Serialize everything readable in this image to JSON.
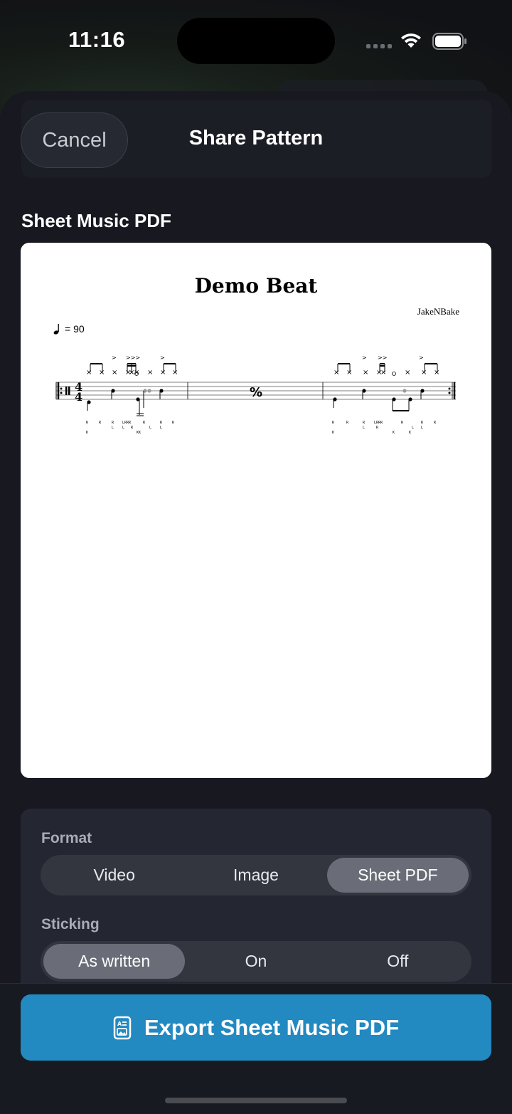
{
  "status_bar": {
    "time": "11:16"
  },
  "header": {
    "cancel_label": "Cancel",
    "title": "Share Pattern"
  },
  "section": {
    "title": "Sheet Music PDF"
  },
  "preview": {
    "title": "Demo Beat",
    "composer": "JakeNBake",
    "tempo_text": "= 90",
    "time_signature": {
      "top": "4",
      "bottom": "4"
    },
    "repeat_symbol": "%"
  },
  "options": {
    "format": {
      "label": "Format",
      "items": [
        "Video",
        "Image",
        "Sheet PDF"
      ],
      "selected": "Sheet PDF"
    },
    "sticking": {
      "label": "Sticking",
      "items": [
        "As written",
        "On",
        "Off"
      ],
      "selected": "As written"
    }
  },
  "export": {
    "label": "Export Sheet Music PDF",
    "icon": "document-icon"
  },
  "colors": {
    "accent": "#2389c1",
    "background": "#171820",
    "panel": "#242631"
  }
}
